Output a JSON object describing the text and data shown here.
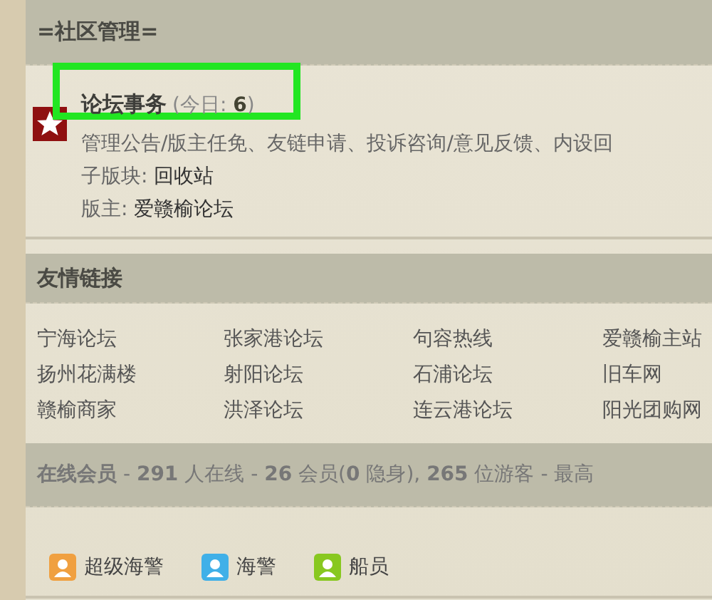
{
  "category": {
    "title": "=社区管理="
  },
  "forum": {
    "name": "论坛事务",
    "today_label": "(今日: ",
    "today_count": "6",
    "today_close": ")",
    "highlighted": true,
    "description": "管理公告/版主任免、友链申请、投诉咨询/意见反馈、内设回",
    "subforum_label": "子版块: ",
    "subforum": "回收站",
    "moderator_label": "版主: ",
    "moderator": "爱赣榆论坛"
  },
  "friend_links": {
    "title": "友情链接",
    "links": [
      "宁海论坛",
      "张家港论坛",
      "句容热线",
      "爱赣榆主站",
      "扬州花满楼",
      "射阳论坛",
      "石浦论坛",
      "旧车网",
      "赣榆商家",
      "洪泽论坛",
      "连云港论坛",
      "阳光团购网"
    ]
  },
  "online": {
    "text": "**在线会员** - **291** 人在线 - **26** 会员(**0** 隐身), **265** 位游客 - 最高"
  },
  "legend": [
    {
      "label": "超级海警",
      "color": "#f0a040"
    },
    {
      "label": "海警",
      "color": "#40b0e8"
    },
    {
      "label": "船员",
      "color": "#88c820"
    }
  ]
}
